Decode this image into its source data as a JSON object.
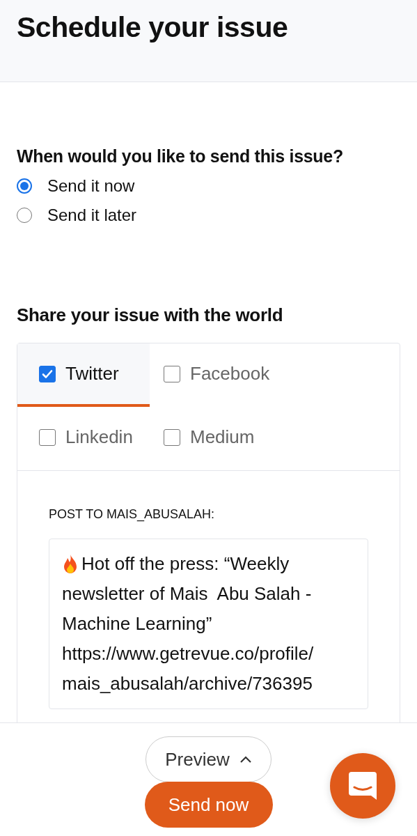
{
  "header": {
    "title": "Schedule your issue"
  },
  "schedule": {
    "question": "When would you like to send this issue?",
    "options": [
      {
        "label": "Send it now",
        "selected": true
      },
      {
        "label": "Send it later",
        "selected": false
      }
    ]
  },
  "share": {
    "heading": "Share your issue with the world",
    "networks": [
      {
        "label": "Twitter",
        "checked": true,
        "selected": true
      },
      {
        "label": "Facebook",
        "checked": false,
        "selected": false
      },
      {
        "label": "Linkedin",
        "checked": false,
        "selected": false
      },
      {
        "label": "Medium",
        "checked": false,
        "selected": false
      }
    ],
    "post_label": "POST TO MAIS_ABUSALAH:",
    "post_lines": [
      "Hot off the press: “Weekly",
      "newsletter of Mais  Abu Salah -",
      "Machine Learning”",
      "https://www.getrevue.co/profile/",
      "mais_abusalah/archive/736395"
    ]
  },
  "footer": {
    "preview": "Preview",
    "send": "Send now"
  }
}
